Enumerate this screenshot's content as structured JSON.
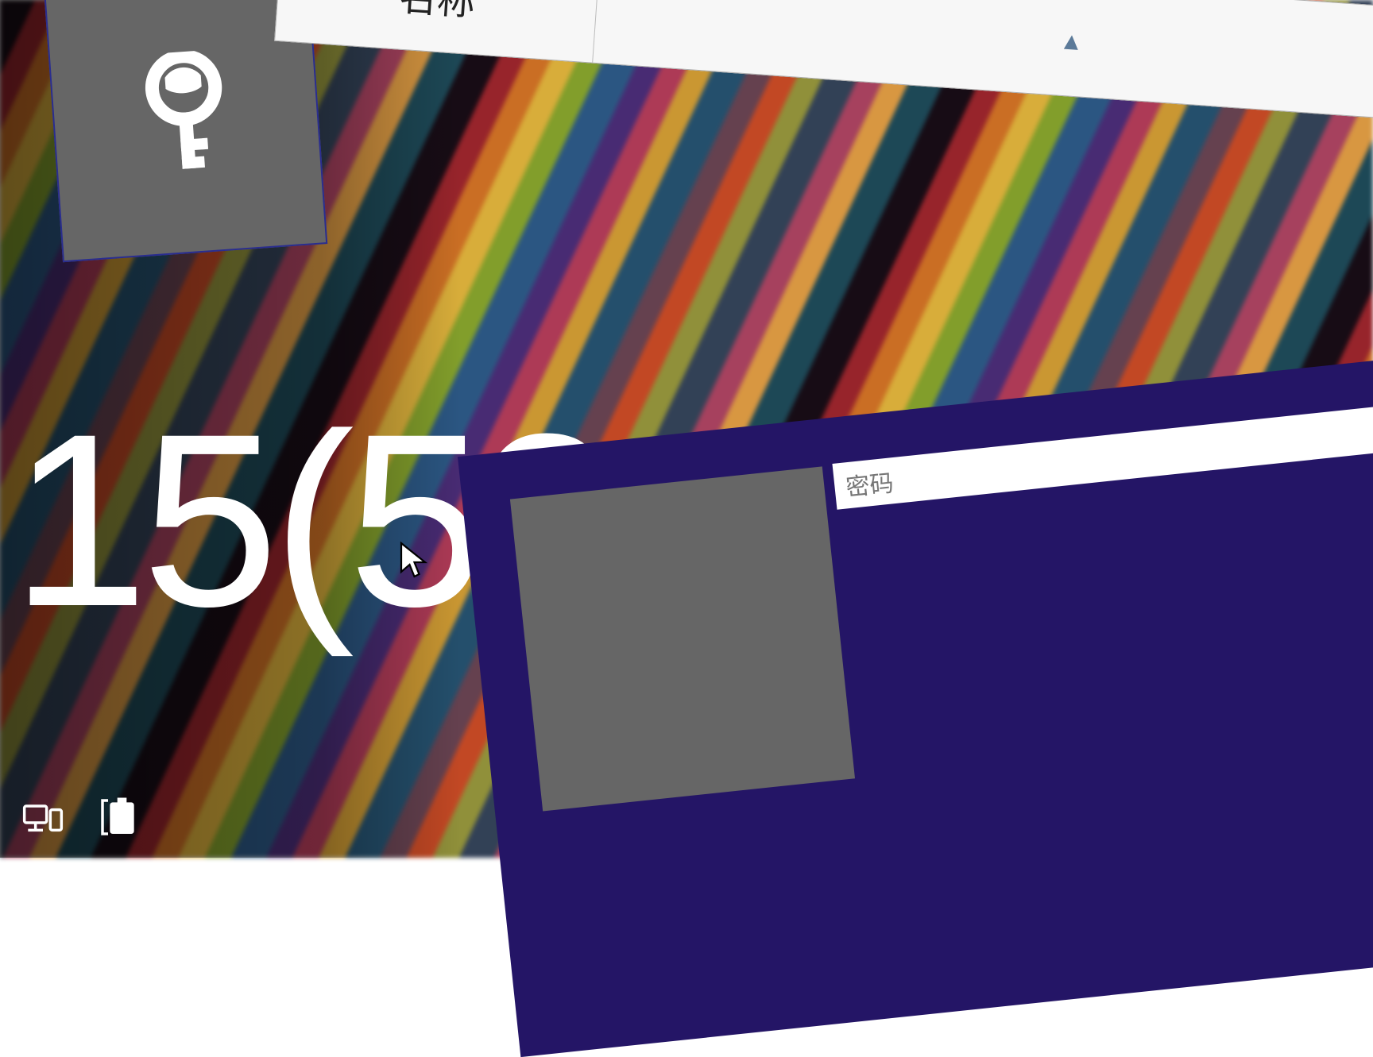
{
  "lockscreen": {
    "time": "15(53",
    "tray": {
      "network_icon": "network-icon",
      "battery_icon": "battery-charging-icon"
    }
  },
  "key_tile": {
    "icon": "key-icon"
  },
  "column_header": {
    "name_label": "名称",
    "sort_indicator": "▴"
  },
  "login_panel": {
    "password_placeholder": "密码",
    "avatar_icon": "avatar-placeholder"
  },
  "cursor": {
    "icon": "mouse-pointer"
  },
  "colors": {
    "panel_bg": "#241566",
    "tile_bg": "#666666",
    "header_bg": "#f7f7f7"
  }
}
